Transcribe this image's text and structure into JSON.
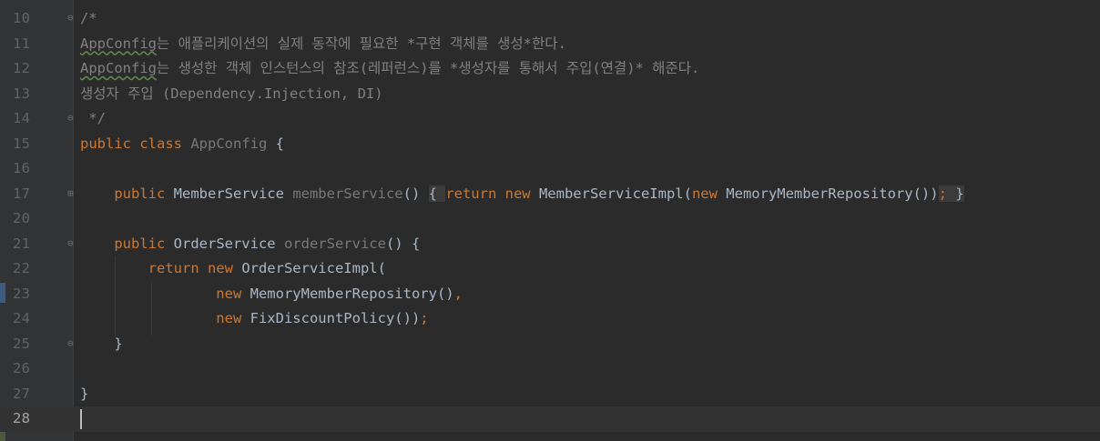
{
  "editor": {
    "language": "java",
    "current_line": 28,
    "lines": [
      {
        "number": "10",
        "fold": "⊖",
        "segments": [
          {
            "text": "/*",
            "cls": "comment"
          }
        ]
      },
      {
        "number": "11",
        "fold": "",
        "segments": [
          {
            "text": "AppConfig",
            "cls": "comment squiggle"
          },
          {
            "text": "는 애플리케이션의 실제 동작에 필요한 *구현 객체를 생성*한다.",
            "cls": "comment"
          }
        ]
      },
      {
        "number": "12",
        "fold": "",
        "segments": [
          {
            "text": "AppConfig",
            "cls": "comment squiggle"
          },
          {
            "text": "는 생성한 객체 인스턴스의 참조(레퍼런스)를 *생성자를 통해서 주입(연결)* 해준다.",
            "cls": "comment"
          }
        ]
      },
      {
        "number": "13",
        "fold": "",
        "segments": [
          {
            "text": "생성자 주입 (Dependency.Injection, DI)",
            "cls": "comment"
          }
        ]
      },
      {
        "number": "14",
        "fold": "⊖",
        "segments": [
          {
            "text": " */",
            "cls": "comment"
          }
        ]
      },
      {
        "number": "15",
        "fold": "",
        "segments": [
          {
            "text": "public class ",
            "cls": "kw"
          },
          {
            "text": "AppConfig ",
            "cls": "fn-gray"
          },
          {
            "text": "{",
            "cls": "cls"
          }
        ]
      },
      {
        "number": "16",
        "fold": "",
        "segments": []
      },
      {
        "number": "17",
        "fold": "⊞",
        "segments": [
          {
            "text": "    public ",
            "cls": "kw"
          },
          {
            "text": "MemberService ",
            "cls": "cls"
          },
          {
            "text": "memberService",
            "cls": "fn-gray"
          },
          {
            "text": "() ",
            "cls": "cls"
          },
          {
            "text": "{ ",
            "cls": "cls brace-hl"
          },
          {
            "text": "return new ",
            "cls": "kw"
          },
          {
            "text": "MemberServiceImpl(",
            "cls": "cls"
          },
          {
            "text": "new ",
            "cls": "kw"
          },
          {
            "text": "MemoryMemberRepository())",
            "cls": "cls"
          },
          {
            "text": "; ",
            "cls": "kw brace-hl"
          },
          {
            "text": "}",
            "cls": "cls brace-hl"
          }
        ]
      },
      {
        "number": "20",
        "fold": "",
        "segments": []
      },
      {
        "number": "21",
        "fold": "⊖",
        "segments": [
          {
            "text": "    public ",
            "cls": "kw"
          },
          {
            "text": "OrderService ",
            "cls": "cls"
          },
          {
            "text": "orderService",
            "cls": "fn-gray"
          },
          {
            "text": "() {",
            "cls": "cls"
          }
        ]
      },
      {
        "number": "22",
        "fold": "",
        "segments": [
          {
            "text": "        return new ",
            "cls": "kw"
          },
          {
            "text": "OrderServiceImpl(",
            "cls": "cls"
          }
        ]
      },
      {
        "number": "23",
        "fold": "",
        "segments": [
          {
            "text": "                new ",
            "cls": "kw"
          },
          {
            "text": "MemoryMemberRepository()",
            "cls": "cls"
          },
          {
            "text": ",",
            "cls": "kw"
          }
        ]
      },
      {
        "number": "24",
        "fold": "",
        "segments": [
          {
            "text": "                new ",
            "cls": "kw"
          },
          {
            "text": "FixDiscountPolicy())",
            "cls": "cls"
          },
          {
            "text": ";",
            "cls": "kw"
          }
        ]
      },
      {
        "number": "25",
        "fold": "⊖",
        "segments": [
          {
            "text": "    }",
            "cls": "cls"
          }
        ]
      },
      {
        "number": "26",
        "fold": "",
        "segments": []
      },
      {
        "number": "27",
        "fold": "",
        "segments": [
          {
            "text": "}",
            "cls": "cls"
          }
        ]
      },
      {
        "number": "28",
        "fold": "",
        "segments": []
      }
    ]
  },
  "colors": {
    "background": "#2b2b2b",
    "gutter": "#313335",
    "keyword": "#cc7832",
    "comment": "#808080",
    "identifier": "#a9b7c6",
    "line_number": "#606366"
  }
}
